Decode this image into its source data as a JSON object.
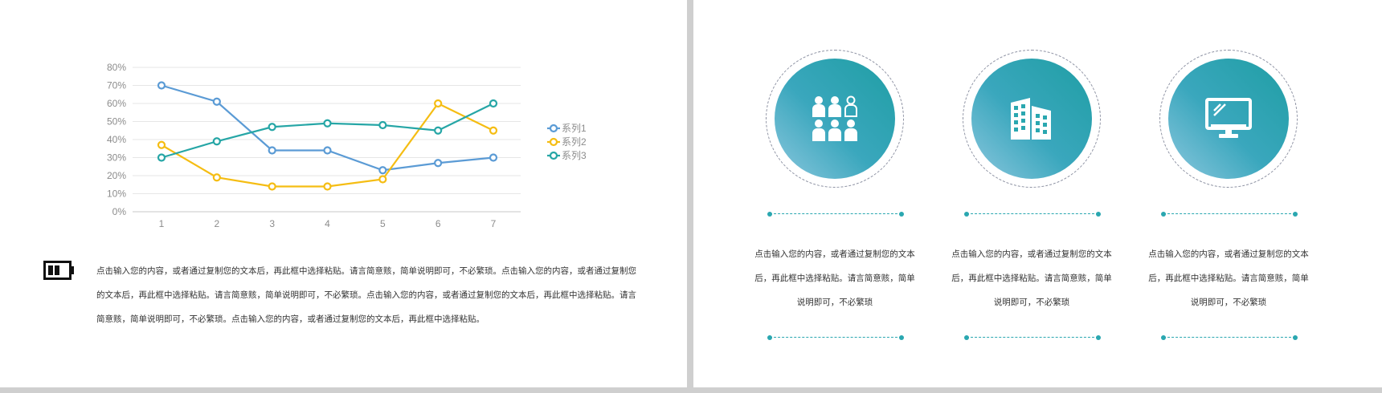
{
  "left_slide": {
    "body_text": "点击输入您的内容，或者通过复制您的文本后，再此框中选择粘贴。请言简意赅，简单说明即可，不必繁琐。点击输入您的内容，或者通过复制您的文本后，再此框中选择粘贴。请言简意赅，简单说明即可，不必繁琐。点击输入您的内容，或者通过复制您的文本后，再此框中选择粘贴。请言简意赅，简单说明即可，不必繁琐。点击输入您的内容，或者通过复制您的文本后，再此框中选择粘贴。",
    "icon": "battery-icon"
  },
  "chart_data": {
    "type": "line",
    "x": [
      1,
      2,
      3,
      4,
      5,
      6,
      7
    ],
    "yticks": [
      "0%",
      "10%",
      "20%",
      "30%",
      "40%",
      "50%",
      "60%",
      "70%",
      "80%"
    ],
    "ylim": [
      0,
      80
    ],
    "grid": true,
    "legend": "right",
    "series": [
      {
        "name": "系列1",
        "color": "#5b9bd5",
        "values": [
          70,
          61,
          34,
          34,
          23,
          27,
          30
        ]
      },
      {
        "name": "系列2",
        "color": "#f5bd13",
        "values": [
          37,
          19,
          14,
          14,
          18,
          60,
          45
        ]
      },
      {
        "name": "系列3",
        "color": "#26a6a6",
        "values": [
          30,
          39,
          47,
          49,
          48,
          45,
          60
        ]
      }
    ]
  },
  "right_slide": {
    "features": [
      {
        "icon": "people-icon",
        "text": "点击输入您的内容，或者通过复制您的文本后，再此框中选择粘贴。请言简意赅，简单说明即可，不必繁琐"
      },
      {
        "icon": "building-icon",
        "text": "点击输入您的内容，或者通过复制您的文本后，再此框中选择粘贴。请言简意赅，简单说明即可，不必繁琐"
      },
      {
        "icon": "monitor-icon",
        "text": "点击输入您的内容，或者通过复制您的文本后，再此框中选择粘贴。请言简意赅，简单说明即可，不必繁琐"
      }
    ],
    "accent_color": "#2aa7b0"
  }
}
